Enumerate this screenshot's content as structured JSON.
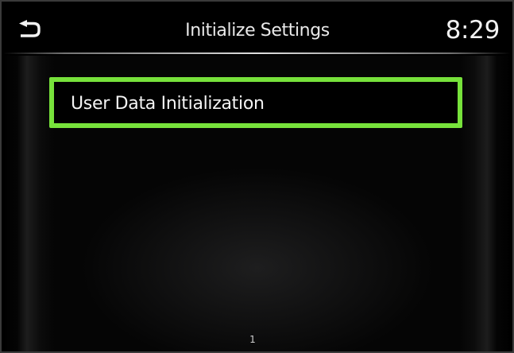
{
  "header": {
    "back_icon": "back-arrow-icon",
    "title": "Initialize Settings",
    "clock": "8:29"
  },
  "menu": {
    "items": [
      {
        "label": "User Data Initialization",
        "selected": true
      }
    ],
    "highlight_color": "#77e23b"
  },
  "pagination": {
    "current_page": "1"
  }
}
